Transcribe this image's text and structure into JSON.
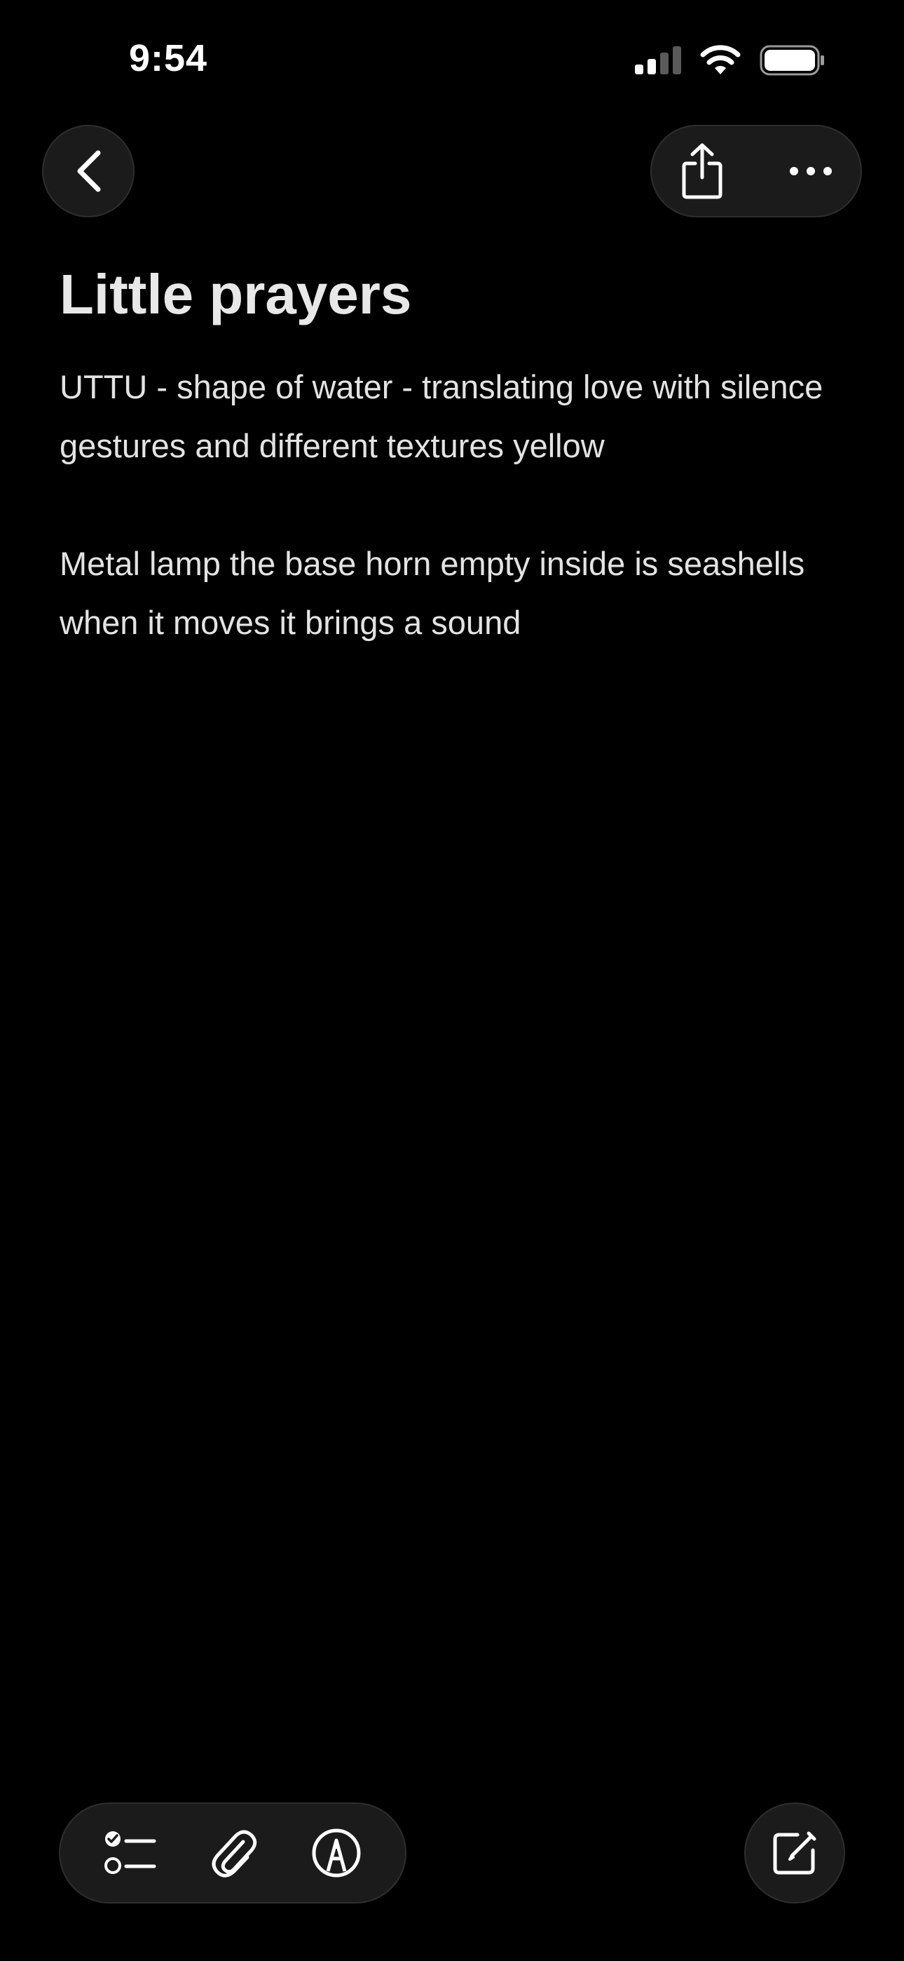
{
  "status_bar": {
    "time": "9:54"
  },
  "icons": {
    "back": "chevron-left-icon",
    "share": "share-icon",
    "more": "ellipsis-icon",
    "checklist": "checklist-icon",
    "attachment": "paperclip-icon",
    "markup": "markup-pen-icon",
    "compose": "compose-icon",
    "signal": "cellular-signal-icon",
    "wifi": "wifi-icon",
    "battery": "battery-icon"
  },
  "colors": {
    "background": "#000000",
    "button_fill": "#1b1b1b",
    "text": "#e6e6e6"
  },
  "note": {
    "title": "Little prayers",
    "paragraphs": [
      "UTTU - shape of water - translating love with silence gestures and different textures yellow",
      "Metal lamp the base horn empty inside is seashells when it moves it brings a sound"
    ]
  }
}
